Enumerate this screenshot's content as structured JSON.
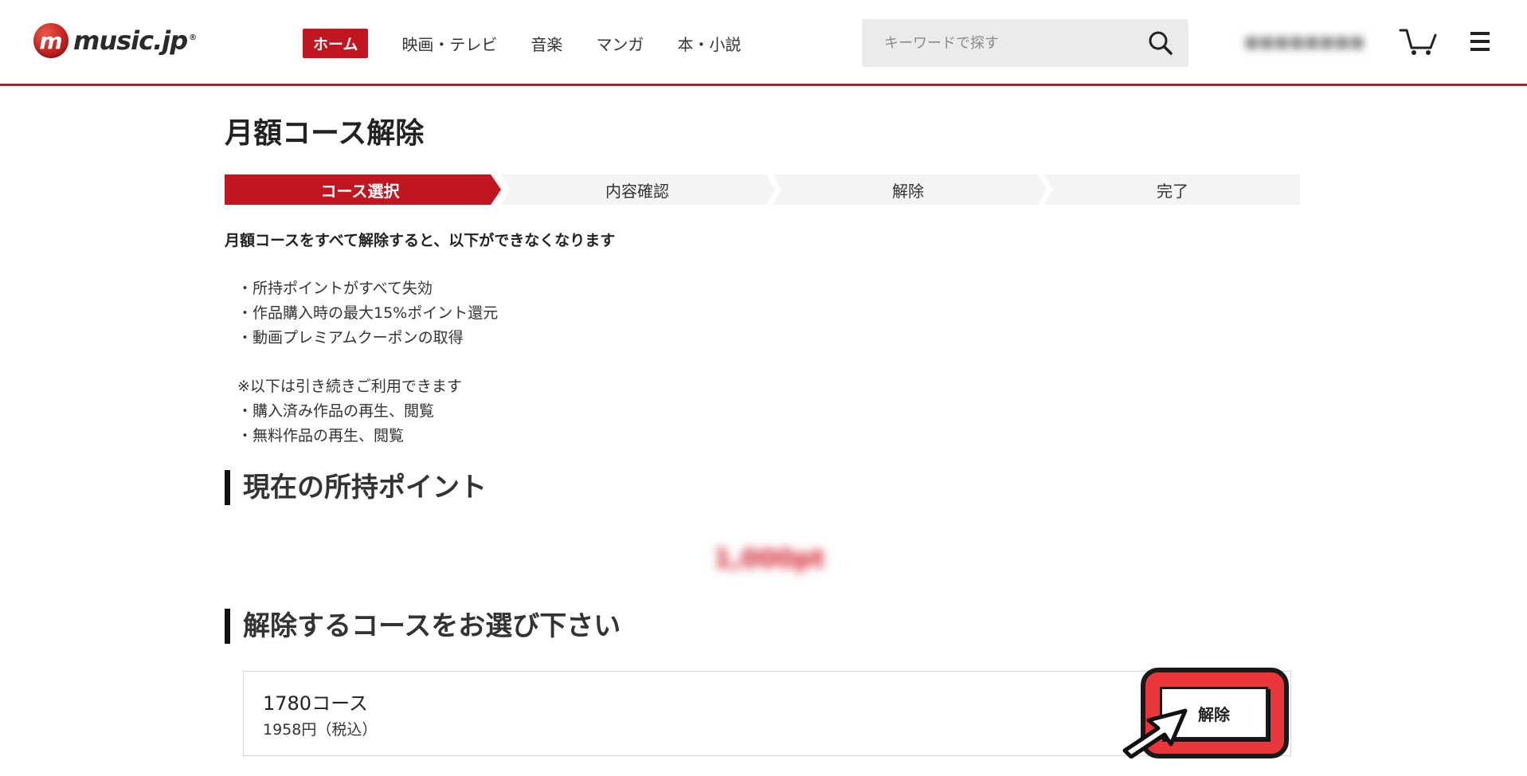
{
  "header": {
    "logo_mark": "m",
    "logo_text": "music.jp",
    "logo_reg": "®",
    "nav": [
      {
        "label": "ホーム",
        "active": true
      },
      {
        "label": "映画・テレビ",
        "active": false
      },
      {
        "label": "音楽",
        "active": false
      },
      {
        "label": "マンガ",
        "active": false
      },
      {
        "label": "本・小説",
        "active": false
      }
    ],
    "search_placeholder": "キーワードで探す",
    "icons": [
      "search-icon",
      "cart-icon",
      "hamburger-menu-icon"
    ]
  },
  "main": {
    "title": "月額コース解除",
    "steps": [
      {
        "label": "コース選択",
        "active": true
      },
      {
        "label": "内容確認",
        "active": false
      },
      {
        "label": "解除",
        "active": false
      },
      {
        "label": "完了",
        "active": false
      }
    ],
    "intro": "月額コースをすべて解除すると、以下ができなくなります",
    "lost_items": [
      "・所持ポイントがすべて失効",
      "・作品購入時の最大15%ポイント還元",
      "・動画プレミアムクーポンの取得"
    ],
    "note_head": "※以下は引き続きご利用できます",
    "kept_items": [
      "・購入済み作品の再生、閲覧",
      "・無料作品の再生、閲覧"
    ],
    "points_heading": "現在の所持ポイント",
    "courses_heading": "解除するコースをお選び下さい",
    "course": {
      "name": "1780コース",
      "price": "1958円（税込）",
      "cancel_label": "解除"
    }
  },
  "colors": {
    "brand_red": "#c0161f",
    "header_border": "#a8232b",
    "highlight_red": "#e8363a",
    "step_inactive": "#f4f4f4"
  }
}
